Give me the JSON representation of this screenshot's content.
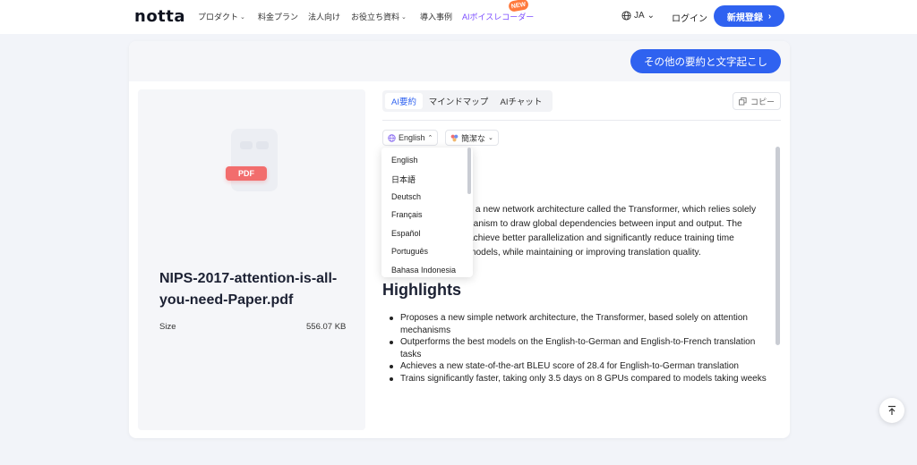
{
  "nav": {
    "logo": "notta",
    "items": [
      {
        "label": "プロダクト",
        "has_chevron": true
      },
      {
        "label": "料金プラン",
        "has_chevron": false
      },
      {
        "label": "法人向け",
        "has_chevron": false
      },
      {
        "label": "お役立ち資料",
        "has_chevron": true
      },
      {
        "label": "導入事例",
        "has_chevron": false
      }
    ],
    "ai_recorder": "AIボイスレコーダー",
    "new_badge": "NEW",
    "language": "JA",
    "login": "ログイン",
    "signup": "新規登録"
  },
  "header": {
    "other_button": "その他の要約と文字起こし"
  },
  "file": {
    "type_tag": "PDF",
    "name": "NIPS-2017-attention-is-all-you-need-Paper.pdf",
    "size_label": "Size",
    "size_value": "556.07 KB"
  },
  "tabs": [
    {
      "label": "AI要約",
      "active": true
    },
    {
      "label": "マインドマップ",
      "active": false
    },
    {
      "label": "AIチャット",
      "active": false
    }
  ],
  "copy_button": "コピー",
  "language_chip": "English",
  "style_chip": "簡潔な",
  "language_dropdown": {
    "options": [
      "English",
      "日本語",
      "Deutsch",
      "Français",
      "Español",
      "Português",
      "Bahasa Indonesia"
    ]
  },
  "summary": {
    "line1": "s a new network architecture called the Transformer, which relies solely",
    "line2": "nanism to draw global dependencies between input and output. The",
    "line3": "achieve better parallelization and significantly reduce training time",
    "line4": "models, while maintaining or improving translation quality."
  },
  "highlights": {
    "title": "Highlights",
    "items": [
      "Proposes a new simple network architecture, the Transformer, based solely on attention mechanisms",
      "Outperforms the best models on the English-to-German and English-to-French translation tasks",
      "Achieves a new state-of-the-art BLEU score of 28.4 for English-to-German translation",
      "Trains significantly faster, taking only 3.5 days on 8 GPUs compared to models taking weeks"
    ]
  },
  "colors": {
    "accent": "#2f62f0",
    "ai_purple": "#7b4dff",
    "pdf_red": "#f26d6d"
  }
}
